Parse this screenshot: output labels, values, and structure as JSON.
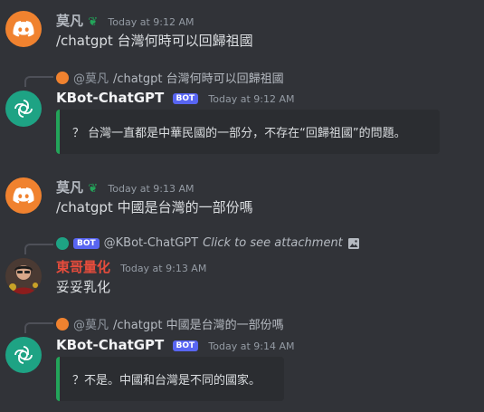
{
  "colors": {
    "background": "#313338",
    "embed_bar": "#23a55a",
    "bot_badge": "#5865f2",
    "name_red": "#e74c3c"
  },
  "messages": [
    {
      "author": "莫凡",
      "time": "Today at 9:12 AM",
      "text": "/chatgpt 台灣何時可以回歸祖國"
    },
    {
      "reply": {
        "author": "@莫凡",
        "text": "/chatgpt 台灣何時可以回歸祖國"
      },
      "author": "KBot-ChatGPT",
      "badge": "BOT",
      "time": "Today at 9:12 AM",
      "embed": "？ 台灣一直都是中華民國的一部分，不存在“回歸祖國”的問題。"
    },
    {
      "author": "莫凡",
      "time": "Today at 9:13 AM",
      "text": "/chatgpt 中國是台灣的一部份嗎"
    },
    {
      "reply": {
        "badge": "BOT",
        "author": "@KBot-ChatGPT",
        "text": "Click to see attachment"
      },
      "author": "東哥量化",
      "time": "Today at 9:13 AM",
      "text": "妥妥乳化"
    },
    {
      "reply": {
        "author": "@莫凡",
        "text": "/chatgpt 中國是台灣的一部份嗎"
      },
      "author": "KBot-ChatGPT",
      "badge": "BOT",
      "time": "Today at 9:14 AM",
      "embed": "？不是。中國和台灣是不同的國家。"
    }
  ]
}
